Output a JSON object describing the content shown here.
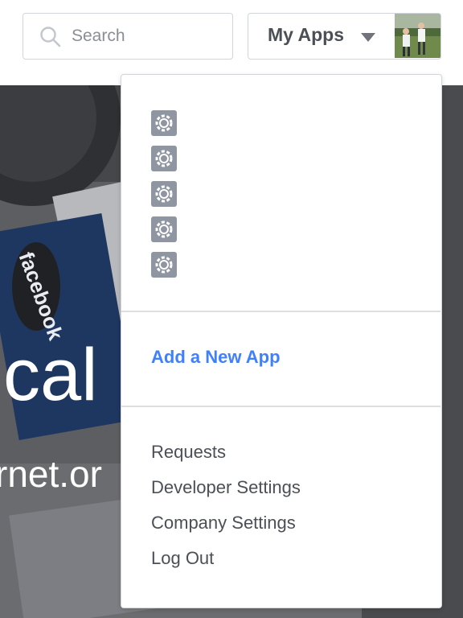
{
  "header": {
    "search_placeholder": "Search",
    "my_apps_label": "My Apps"
  },
  "hero": {
    "line1": "cal",
    "line2": "rnet.or",
    "laptop_brand": "facebook"
  },
  "dropdown": {
    "apps": [
      {
        "icon": "gear-icon"
      },
      {
        "icon": "gear-icon"
      },
      {
        "icon": "gear-icon"
      },
      {
        "icon": "gear-icon"
      },
      {
        "icon": "gear-icon"
      }
    ],
    "add_app_label": "Add a New App",
    "menu": {
      "requests": "Requests",
      "developer_settings": "Developer Settings",
      "company_settings": "Company Settings",
      "log_out": "Log Out"
    }
  },
  "colors": {
    "accent": "#4080ff",
    "text": "#4b4f56",
    "border": "#d2d5da"
  }
}
